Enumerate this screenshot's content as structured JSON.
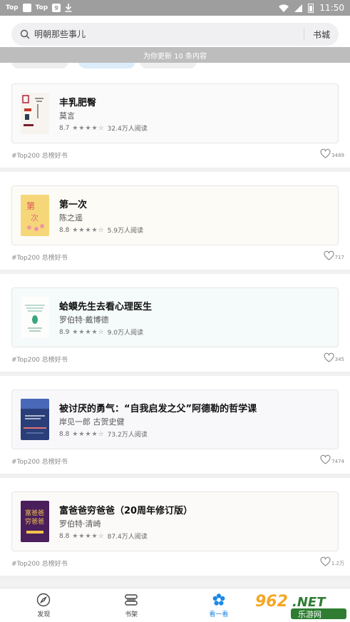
{
  "status_bar": {
    "left_label_1": "Top",
    "left_label_2": "Top",
    "left_box_2": "9",
    "time": "11:50"
  },
  "search": {
    "placeholder": "明朝那些事儿",
    "store_label": "书城"
  },
  "banner": {
    "text": "为你更新 10 条内容"
  },
  "feed": [
    {
      "title": "丰乳肥臀",
      "author": "莫言",
      "rating": "8.7",
      "stars": "★★★★☆",
      "reads": "32.4万人阅读",
      "tag": "#Top200 总榜好书",
      "likes": "3489"
    },
    {
      "title": "第一次",
      "author": "陈之遥",
      "rating": "8.8",
      "stars": "★★★★☆",
      "reads": "5.9万人阅读",
      "tag": "#Top200 总榜好书",
      "likes": "717"
    },
    {
      "title": "蛤蟆先生去看心理医生",
      "author": "罗伯特·戴博德",
      "rating": "8.9",
      "stars": "★★★★☆",
      "reads": "9.0万人阅读",
      "tag": "#Top200 总榜好书",
      "likes": "345"
    },
    {
      "title": "被讨厌的勇气：“自我启发之父”阿德勒的哲学课",
      "author": "岸见一郎 古贺史健",
      "rating": "8.8",
      "stars": "★★★★☆",
      "reads": "73.2万人阅读",
      "tag": "#Top200 总榜好书",
      "likes": "7474"
    },
    {
      "title": "富爸爸穷爸爸（20周年修订版）",
      "author": "罗伯特·清崎",
      "rating": "8.8",
      "stars": "★★★★☆",
      "reads": "87.4万人阅读",
      "tag": "#Top200 总榜好书",
      "likes": "1.2万"
    }
  ],
  "bottom_nav": {
    "discover": "发现",
    "shelf": "书架",
    "look": "看一看"
  },
  "watermark": {
    "number": "962",
    "suffix": ".NET",
    "site": "乐游网"
  },
  "colors": {
    "accent": "#1e88e5",
    "status_bar": "#9e9e9e",
    "banner": "#bdbdbd"
  }
}
